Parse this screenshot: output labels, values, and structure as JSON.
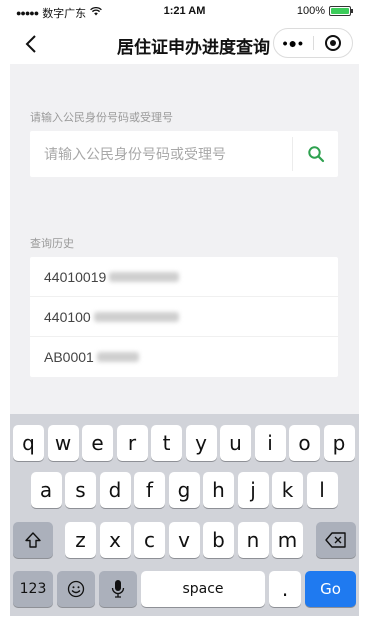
{
  "status_bar": {
    "signal": "●●●●●",
    "carrier": "数字广东",
    "time": "1:21 AM",
    "battery_percent": "100%"
  },
  "nav": {
    "title": "居住证申办进度查询",
    "more_icon": "more-dots-icon",
    "close_icon": "target-circle-icon"
  },
  "search": {
    "label": "请输入公民身份号码或受理号",
    "placeholder": "请输入公民身份号码或受理号",
    "value": "",
    "button_icon": "search-icon",
    "accent_color": "#2ea14f"
  },
  "history": {
    "label": "查询历史",
    "items": [
      {
        "text": "44010019"
      },
      {
        "text": "440100"
      },
      {
        "text": "AB0001"
      }
    ]
  },
  "keyboard": {
    "row1": [
      "q",
      "w",
      "e",
      "r",
      "t",
      "y",
      "u",
      "i",
      "o",
      "p"
    ],
    "row2": [
      "a",
      "s",
      "d",
      "f",
      "g",
      "h",
      "j",
      "k",
      "l"
    ],
    "row3": [
      "z",
      "x",
      "c",
      "v",
      "b",
      "n",
      "m"
    ],
    "shift_icon": "shift-icon",
    "delete_icon": "backspace-icon",
    "numbers_label": "123",
    "emoji_icon": "emoji-icon",
    "mic_icon": "microphone-icon",
    "space_label": "space",
    "period_label": ".",
    "go_label": "Go",
    "go_color": "#1f7af0"
  }
}
